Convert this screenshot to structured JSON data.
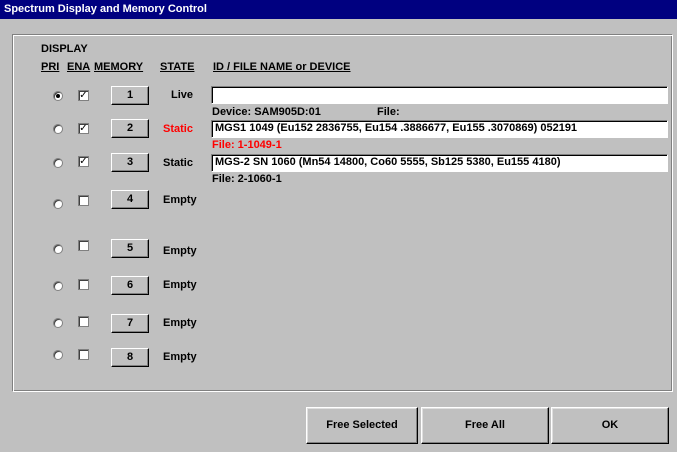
{
  "window": {
    "title": "Spectrum Display and Memory Control"
  },
  "headers": {
    "display": "DISPLAY",
    "pri": "PRI",
    "ena": "ENA",
    "memory": "MEMORY",
    "state": "STATE",
    "id": "ID / FILE NAME or DEVICE"
  },
  "rows": [
    {
      "pri_selected": true,
      "ena_checked": true,
      "memory": "1",
      "state": "Live",
      "state_color": "#000000",
      "field": "",
      "device_line": "Device: SAM905D:01",
      "file_line": "File:",
      "file_color": "#000000"
    },
    {
      "pri_selected": false,
      "ena_checked": true,
      "memory": "2",
      "state": "Static",
      "state_color": "#ff0000",
      "field": "MGS1 1049 (Eu152 2836755, Eu154 .3886677, Eu155 .3070869) 052191",
      "file_line": "File: 1-1049-1",
      "file_color": "#ff0000"
    },
    {
      "pri_selected": false,
      "ena_checked": true,
      "memory": "3",
      "state": "Static",
      "state_color": "#000000",
      "field": "MGS-2 SN 1060 (Mn54 14800, Co60 5555, Sb125 5380, Eu155 4180)",
      "file_line": "File: 2-1060-1",
      "file_color": "#000000"
    },
    {
      "pri_selected": false,
      "ena_checked": false,
      "memory": "4",
      "state": "Empty",
      "state_color": "#000000"
    },
    {
      "pri_selected": false,
      "ena_checked": false,
      "memory": "5",
      "state": "Empty",
      "state_color": "#000000"
    },
    {
      "pri_selected": false,
      "ena_checked": false,
      "memory": "6",
      "state": "Empty",
      "state_color": "#000000"
    },
    {
      "pri_selected": false,
      "ena_checked": false,
      "memory": "7",
      "state": "Empty",
      "state_color": "#000000"
    },
    {
      "pri_selected": false,
      "ena_checked": false,
      "memory": "8",
      "state": "Empty",
      "state_color": "#000000"
    }
  ],
  "buttons": {
    "free_selected": "Free Selected",
    "free_all": "Free All",
    "ok": "OK"
  }
}
